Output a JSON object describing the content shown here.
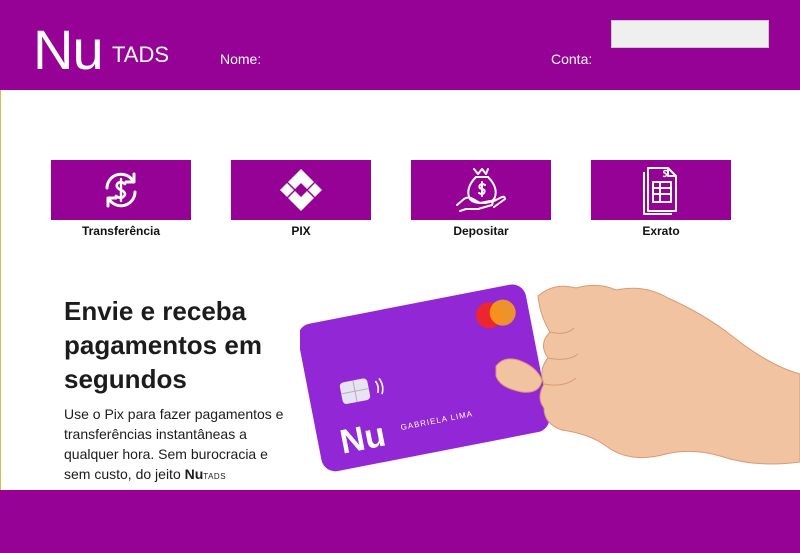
{
  "header": {
    "logo_main": "Nu",
    "logo_sub": "TADS",
    "nome_label": "Nome:",
    "conta_label": "Conta:",
    "conta_value": ""
  },
  "actions": [
    {
      "label": "Transferência",
      "icon": "transfer-dollar-icon"
    },
    {
      "label": "PIX",
      "icon": "pix-icon"
    },
    {
      "label": "Depositar",
      "icon": "money-bag-deposit-icon"
    },
    {
      "label": "Exrato",
      "icon": "statement-document-icon"
    }
  ],
  "promo": {
    "headline": "Envie e receba pagamentos em segundos",
    "body": "Use o Pix para fazer pagamentos e transferências instantâneas a qualquer hora. Sem burocracia e sem custo, do jeito",
    "brand_nu": "Nu",
    "brand_tads": "TADS",
    "card_logo": "Nu",
    "card_holder": "GABRIELA LIMA"
  },
  "colors": {
    "brand_purple": "#960196",
    "card_purple": "#8a1bd0",
    "text_dark": "#1c1c1c"
  }
}
